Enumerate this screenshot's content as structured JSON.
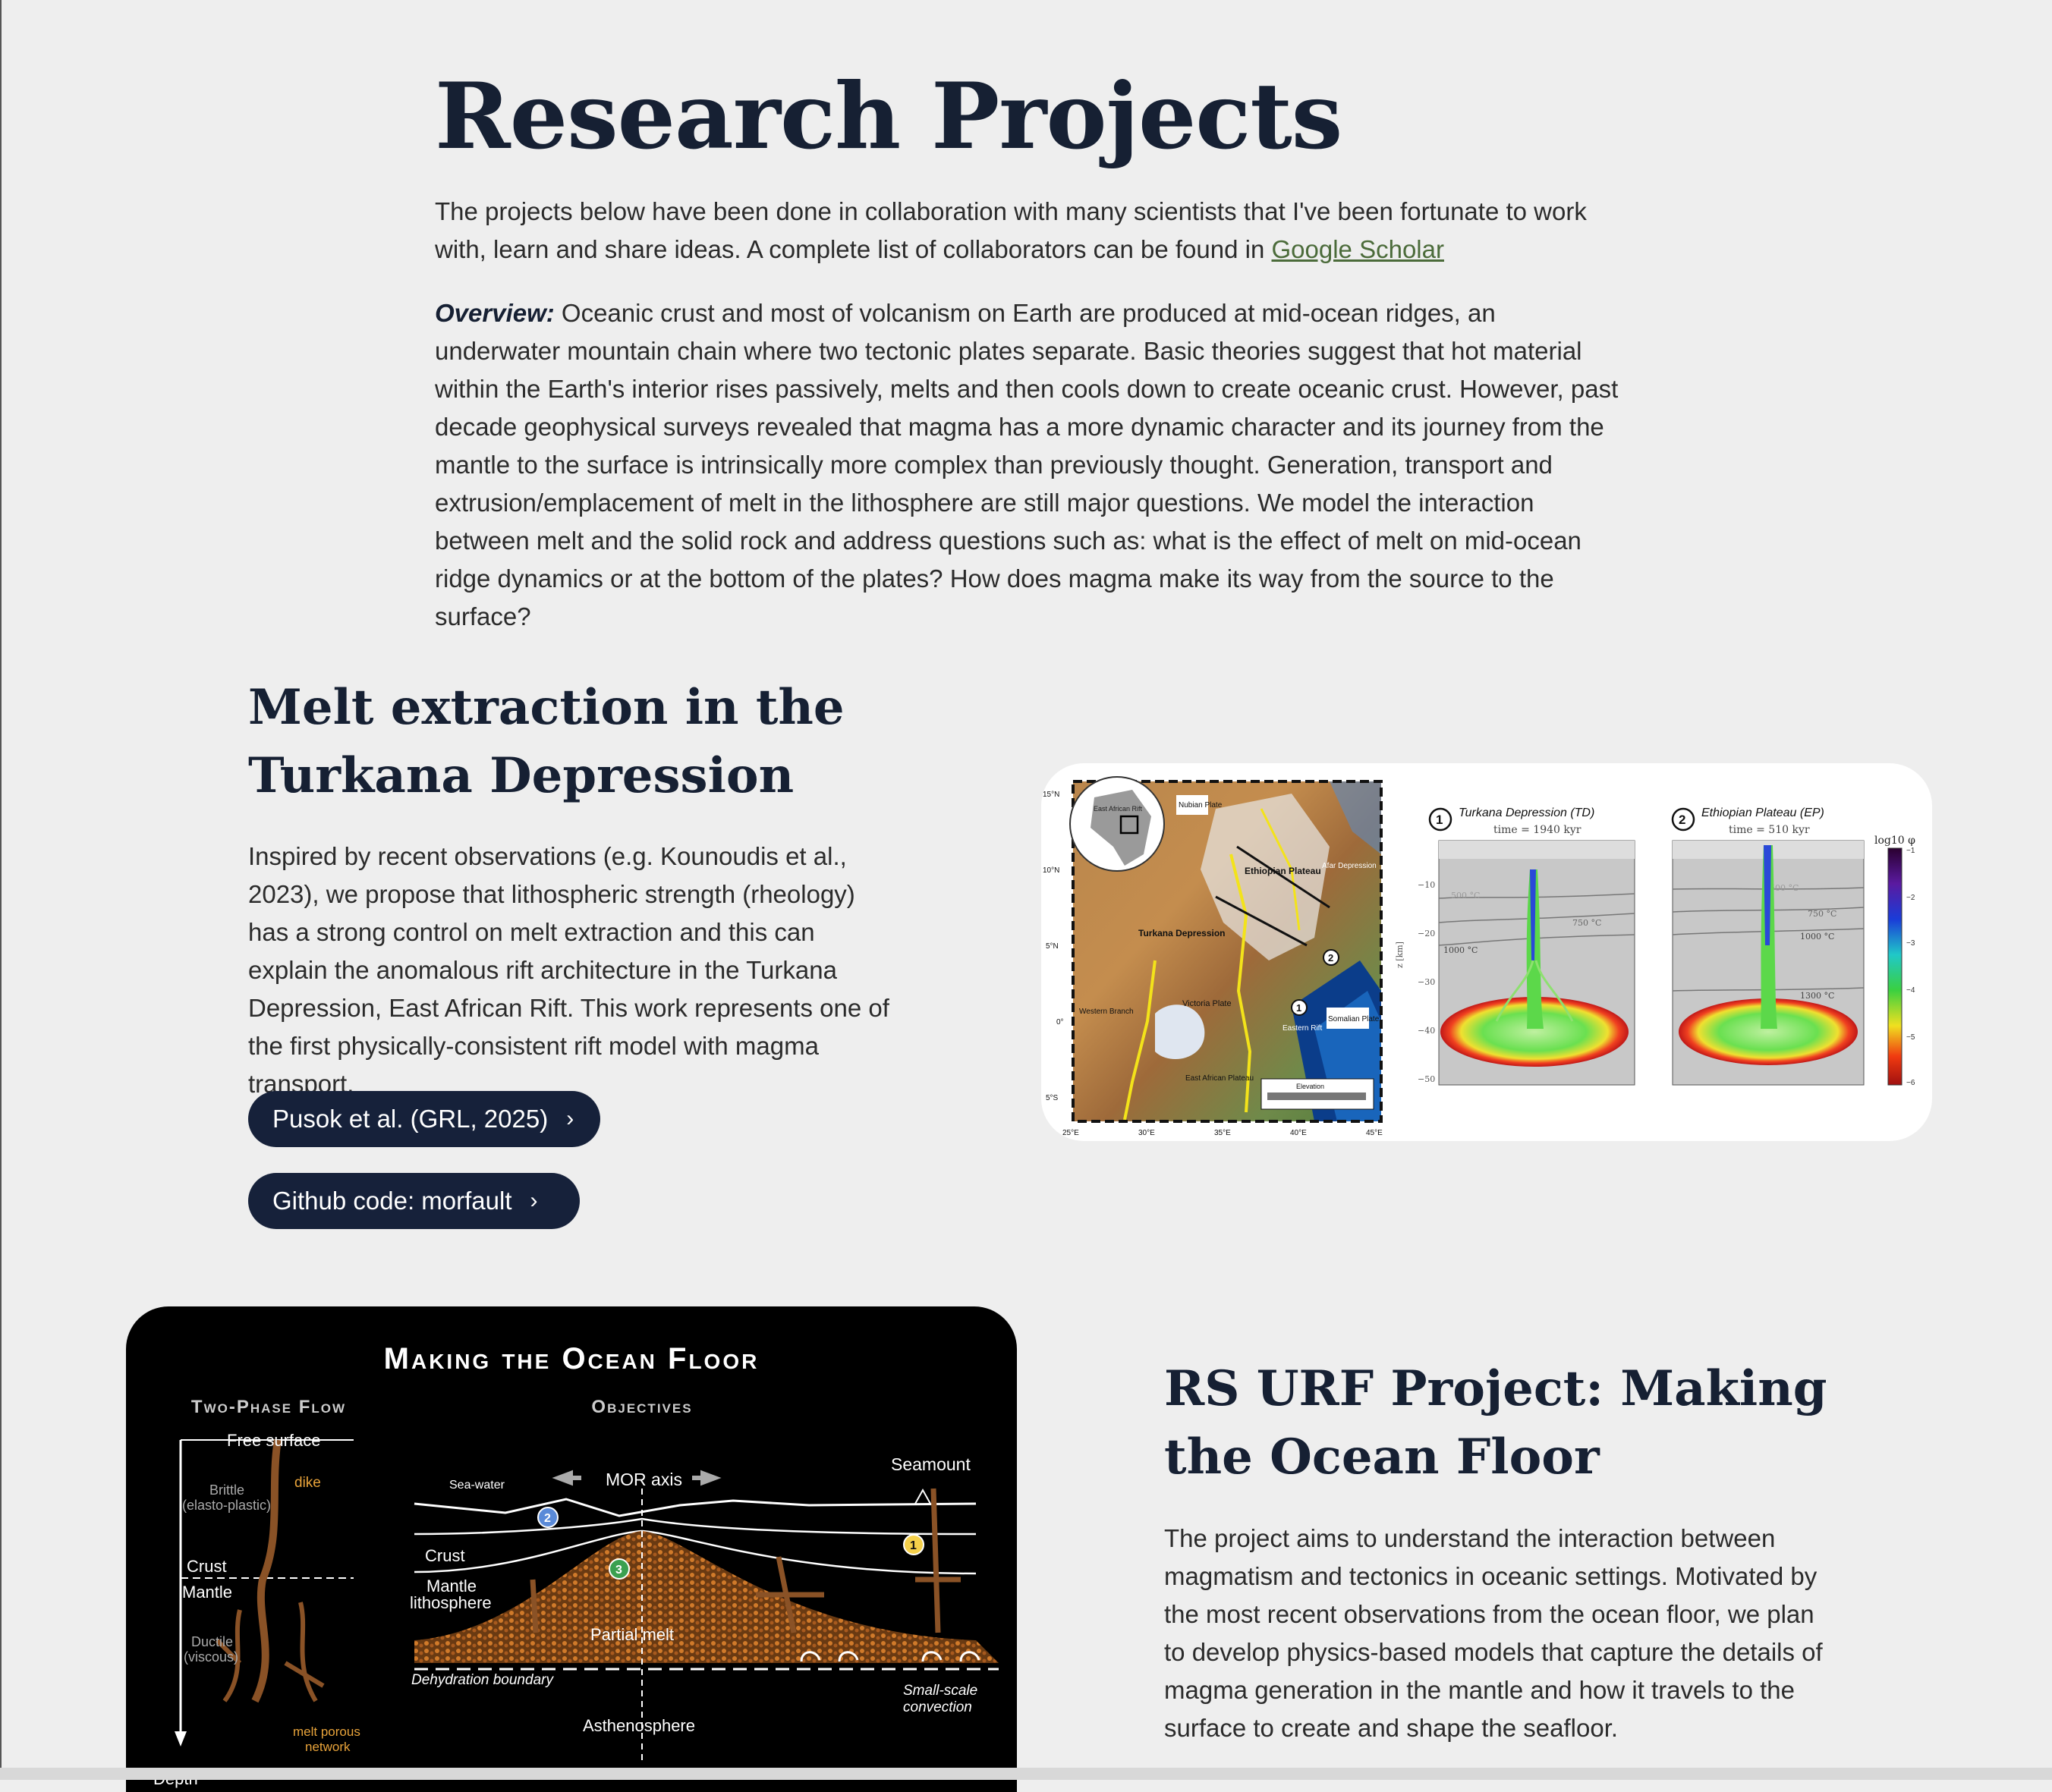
{
  "page": {
    "title": "Research Projects"
  },
  "intro": {
    "text_before": "The projects below have been done in collaboration with many scientists that I've been fortunate to work with, learn and share ideas. A complete list of collaborators can be found in ",
    "link_label": "Google Scholar"
  },
  "overview": {
    "label": "Overview:",
    "text": " Oceanic crust and most of volcanism on Earth are produced at mid-ocean ridges, an underwater mountain chain where two tectonic plates separate. Basic theories suggest that hot material within the Earth's interior rises passively, melts and then cools down to create oceanic crust. However, past decade geophysical surveys revealed that magma has a more dynamic character and its journey from the mantle to the surface is intrinsically more complex than previously thought. Generation, transport and extrusion/emplacement of melt in the lithosphere are still major questions. We model the interaction between melt and the solid rock and address questions such as: what is the effect of melt on mid-ocean ridge dynamics or at the bottom of the plates? How does magma make its way from the source to the surface?"
  },
  "project1": {
    "title": "Melt extraction in the Turkana Depression",
    "description": "Inspired by recent observations (e.g. Kounoudis et al., 2023), we propose that lithospheric strength (rheology) has a strong control on melt extraction and this can explain the anomalous rift architecture in the Turkana Depression, East African Rift. This work represents one of the first physically-consistent rift model with magma transport.",
    "buttons": [
      {
        "label": "Pusok et al. (GRL, 2025)",
        "icon": "chevron-right-icon"
      },
      {
        "label": "Github code: morfault",
        "icon": "chevron-right-icon"
      }
    ],
    "figure": {
      "map_lat_labels": [
        "15°N",
        "10°N",
        "5°N",
        "0°",
        "5°S"
      ],
      "map_lon_labels": [
        "25°E",
        "30°E",
        "35°E",
        "40°E",
        "45°E"
      ],
      "map_labels": {
        "nubian": "Nubian Plate",
        "eastafr": "East African Rift",
        "ethiopian": "Ethiopian Plateau",
        "turkana": "Turkana Depression",
        "victoria": "Victoria Plate",
        "somalian": "Somalian Plate",
        "western": "Western Branch",
        "eastern": "Eastern Rift",
        "eastafrplat": "East African Plateau",
        "afar": "Afar Depression",
        "elevation": "Elevation",
        "marker1": "1",
        "marker2": "2"
      },
      "panel_td": {
        "marker": "1",
        "title": "Turkana Depression (TD)",
        "time": "time = 1940 kyr",
        "iso": [
          "500 °C",
          "750 °C",
          "1000 °C"
        ]
      },
      "panel_ep": {
        "marker": "2",
        "title": "Ethiopian Plateau (EP)",
        "time": "time = 510 kyr",
        "iso": [
          "500 °C",
          "750 °C",
          "1000 °C",
          "1300 °C"
        ]
      },
      "z_label": "z [km]",
      "z_ticks": [
        "−10",
        "−20",
        "−30",
        "−40",
        "−50"
      ],
      "cbar_label": "log10 φ",
      "cbar_ticks": [
        "−1",
        "−2",
        "−3",
        "−4",
        "−5",
        "−6"
      ]
    }
  },
  "project2": {
    "title": "RS URF Project: Making the Ocean Floor",
    "description": "The project aims to understand the interaction between magmatism and tectonics in oceanic settings. Motivated by the most recent observations from the ocean floor, we plan to develop physics-based models that capture the details of magma generation in the mantle and how it travels to the surface to create and shape the seafloor.",
    "figure": {
      "title": "Making the Ocean Floor",
      "sub_left": "Two-Phase Flow",
      "sub_right": "Objectives",
      "labels": {
        "free_surface": "Free surface",
        "brittle": "Brittle",
        "elasto": "(elasto-plastic)",
        "dike": "dike",
        "crust_l": "Crust",
        "mantle_l": "Mantle",
        "ductile": "Ductile",
        "viscous": "(viscous)",
        "depth": "Depth",
        "melt_porous": "melt porous",
        "network": "network",
        "seawater": "Sea-water",
        "mor": "MOR axis",
        "seamount": "Seamount",
        "crust_r": "Crust",
        "mantle_r": "Mantle",
        "litho": "lithosphere",
        "partial_melt": "Partial melt",
        "dehydration": "Dehydration boundary",
        "small_scale": "Small-scale",
        "convection": "convection",
        "astheno": "Asthenosphere",
        "n1": "1",
        "n2": "2",
        "n3": "3"
      }
    }
  }
}
